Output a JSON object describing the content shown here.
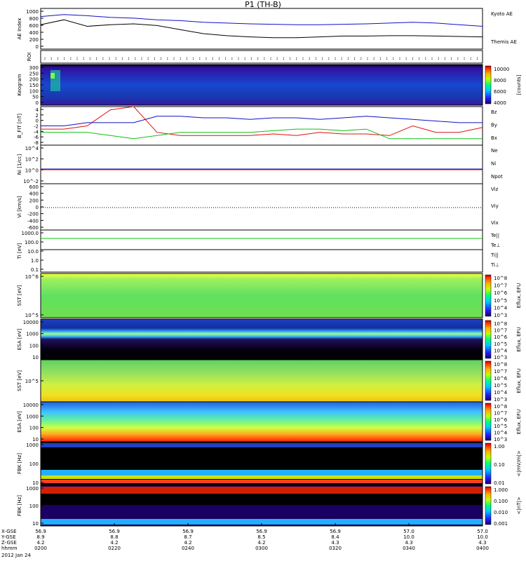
{
  "title": "P1 (TH-B)",
  "date_label": "2012 Jan 24",
  "colors": {
    "blue": "#1010c8",
    "red": "#e01010",
    "green": "#10c010",
    "black": "#000000"
  },
  "ephemeris": {
    "row_labels": [
      "X-GSE",
      "Y-GSE",
      "Z-GSE",
      "hhmm"
    ],
    "columns": [
      {
        "x": "56.9",
        "y": "8.9",
        "z": "4.2",
        "t": "0200"
      },
      {
        "x": "56.9",
        "y": "8.8",
        "z": "4.2",
        "t": "0220"
      },
      {
        "x": "56.9",
        "y": "8.7",
        "z": "4.2",
        "t": "0240"
      },
      {
        "x": "56.9",
        "y": "8.5",
        "z": "4.2",
        "t": "0300"
      },
      {
        "x": "56.9",
        "y": "8.4",
        "z": "4.3",
        "t": "0320"
      },
      {
        "x": "57.0",
        "y": "10.0",
        "z": "4.3",
        "t": "0340"
      },
      {
        "x": "57.0",
        "y": "10.0",
        "z": "4.3",
        "t": "0400"
      }
    ]
  },
  "chart_data": [
    {
      "type": "line",
      "panel": "AE index",
      "ylabel": "AE Index",
      "ylim": [
        0,
        1000
      ],
      "yticks": [
        "1000",
        "800",
        "600",
        "400",
        "200",
        "0"
      ],
      "legend": [
        "Kyoto AE",
        "Themis AE"
      ],
      "series": [
        {
          "name": "Kyoto AE",
          "color": "blue",
          "values": [
            800,
            850,
            820,
            780,
            760,
            720,
            700,
            660,
            640,
            620,
            610,
            600,
            600,
            610,
            620,
            640,
            660,
            640,
            600,
            560
          ]
        },
        {
          "name": "Themis AE",
          "color": "black",
          "values": [
            600,
            720,
            560,
            600,
            620,
            580,
            480,
            380,
            330,
            300,
            280,
            280,
            300,
            320,
            320,
            330,
            330,
            320,
            310,
            300
          ]
        }
      ]
    },
    {
      "type": "heatmap",
      "panel": "ROI",
      "ylabel": "ROI"
    },
    {
      "type": "heatmap",
      "panel": "Keogram",
      "ylabel": "Keogram",
      "ylim": [
        0,
        300
      ],
      "yticks": [
        "300",
        "250",
        "200",
        "150",
        "100",
        "50",
        "0"
      ],
      "colorbar": {
        "label": "[counts]",
        "ticks": [
          "10000",
          "8000",
          "6000",
          "4000"
        ]
      }
    },
    {
      "type": "line",
      "panel": "B FIT",
      "ylabel": "B_FIT [nT]",
      "ylim": [
        -8,
        4
      ],
      "yticks": [
        "4",
        "2",
        "0",
        "-2",
        "-4",
        "-6",
        "-8"
      ],
      "legend": [
        "Bz",
        "By",
        "Bx"
      ],
      "series": [
        {
          "name": "Bz",
          "color": "red",
          "values": [
            -3,
            -3,
            -2,
            3,
            4,
            -4,
            -5,
            -5,
            -5,
            -5,
            -4.5,
            -5,
            -4,
            -4.5,
            -4.5,
            -5,
            -2,
            -4,
            -4,
            -2.5
          ]
        },
        {
          "name": "By",
          "color": "blue",
          "values": [
            -2,
            -2,
            -1,
            -1,
            -1,
            1,
            1,
            0.5,
            0.5,
            0,
            0.5,
            0.5,
            0,
            0.5,
            1,
            0.5,
            0,
            -0.5,
            -1,
            -1
          ]
        },
        {
          "name": "Bx",
          "color": "green",
          "values": [
            -4,
            -4,
            -4,
            -5,
            -6,
            -5,
            -4,
            -4,
            -4,
            -4,
            -3.5,
            -3,
            -3,
            -3.5,
            -3,
            -6,
            -6,
            -6,
            -6,
            -6
          ]
        }
      ]
    },
    {
      "type": "line",
      "panel": "Density",
      "ylabel": "Ni [1/cc]",
      "ylim": [
        -2,
        5
      ],
      "yticks": [
        "10^4",
        "10^2",
        "10^0",
        "10^-2"
      ],
      "legend": [
        "Ne",
        "Ni",
        "Npot"
      ]
    },
    {
      "type": "line",
      "panel": "Velocity",
      "ylabel": "Vi [km/s]",
      "ylim": [
        -800,
        800
      ],
      "yticks": [
        "600",
        "400",
        "200",
        "0",
        "-200",
        "-400",
        "-600"
      ],
      "legend": [
        "Viz",
        "Viy",
        "Vix"
      ]
    },
    {
      "type": "line",
      "panel": "Temperature",
      "ylabel": "Ti [eV]",
      "ylim": [
        0.1,
        1000
      ],
      "yticks": [
        "1000.0",
        "100.0",
        "10.0",
        "1.0",
        "0.1"
      ],
      "legend": [
        "Te||",
        "Te⊥",
        "Ti||",
        "Ti⊥"
      ]
    },
    {
      "type": "heatmap",
      "panel": "SST ion",
      "ylabel": "SST [eV]",
      "yticks": [
        "10^6",
        "10^5"
      ],
      "colorbar": {
        "label": "Eflux, EFU",
        "ticks": [
          "10^8",
          "10^7",
          "10^6",
          "10^5",
          "10^4",
          "10^3"
        ]
      }
    },
    {
      "type": "heatmap",
      "panel": "ESA ion",
      "ylabel": "ESA [eV]",
      "yticks": [
        "10000",
        "1000",
        "100",
        "10"
      ],
      "colorbar": {
        "label": "Eflux, EFU",
        "ticks": [
          "10^8",
          "10^7",
          "10^6",
          "10^5",
          "10^4",
          "10^3"
        ]
      }
    },
    {
      "type": "heatmap",
      "panel": "SST electron",
      "ylabel": "SST [eV]",
      "yticks": [
        "10^5"
      ],
      "colorbar": {
        "label": "Eflux, EFU",
        "ticks": [
          "10^8",
          "10^7",
          "10^6",
          "10^5",
          "10^4",
          "10^3"
        ]
      }
    },
    {
      "type": "heatmap",
      "panel": "ESA electron",
      "ylabel": "ESA [eV]",
      "yticks": [
        "10000",
        "1000",
        "100",
        "10"
      ],
      "colorbar": {
        "label": "Eflux, EFU",
        "ticks": [
          "10^8",
          "10^7",
          "10^6",
          "10^5",
          "10^4",
          "10^3"
        ]
      }
    },
    {
      "type": "heatmap",
      "panel": "FBK E",
      "ylabel": "FBK [Hz]",
      "yticks": [
        "1000",
        "100",
        "10"
      ],
      "colorbar": {
        "label": "<|mV/m|>",
        "ticks": [
          "1.00",
          "0.10",
          "0.01"
        ]
      }
    },
    {
      "type": "heatmap",
      "panel": "FBK B",
      "ylabel": "FBK [Hz]",
      "yticks": [
        "1000",
        "100",
        "10"
      ],
      "colorbar": {
        "label": "<|nT|>",
        "ticks": [
          "1.000",
          "0.100",
          "0.010",
          "0.001"
        ]
      }
    }
  ]
}
